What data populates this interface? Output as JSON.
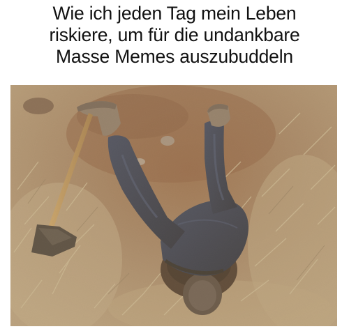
{
  "caption": {
    "line1": "Wie ich jeden Tag mein Leben",
    "line2": "riskiere, um für die undankbare",
    "line3": "Masse Memes auszubuddeln"
  },
  "photo": {
    "content": "person stuck upside down in a dug hole in dry dirt, legs in jeans sticking up, a hoe lying beside",
    "colors": {
      "soil_light": "#b9a07c",
      "soil_dark": "#7a5a3e",
      "soil_red": "#8d5a3b",
      "grass": "#c9b68e",
      "jeans": "#1f2b45",
      "boots": "#8b7a6a",
      "hoe_handle": "#c79a58",
      "hoe_blade": "#3a3530"
    }
  }
}
